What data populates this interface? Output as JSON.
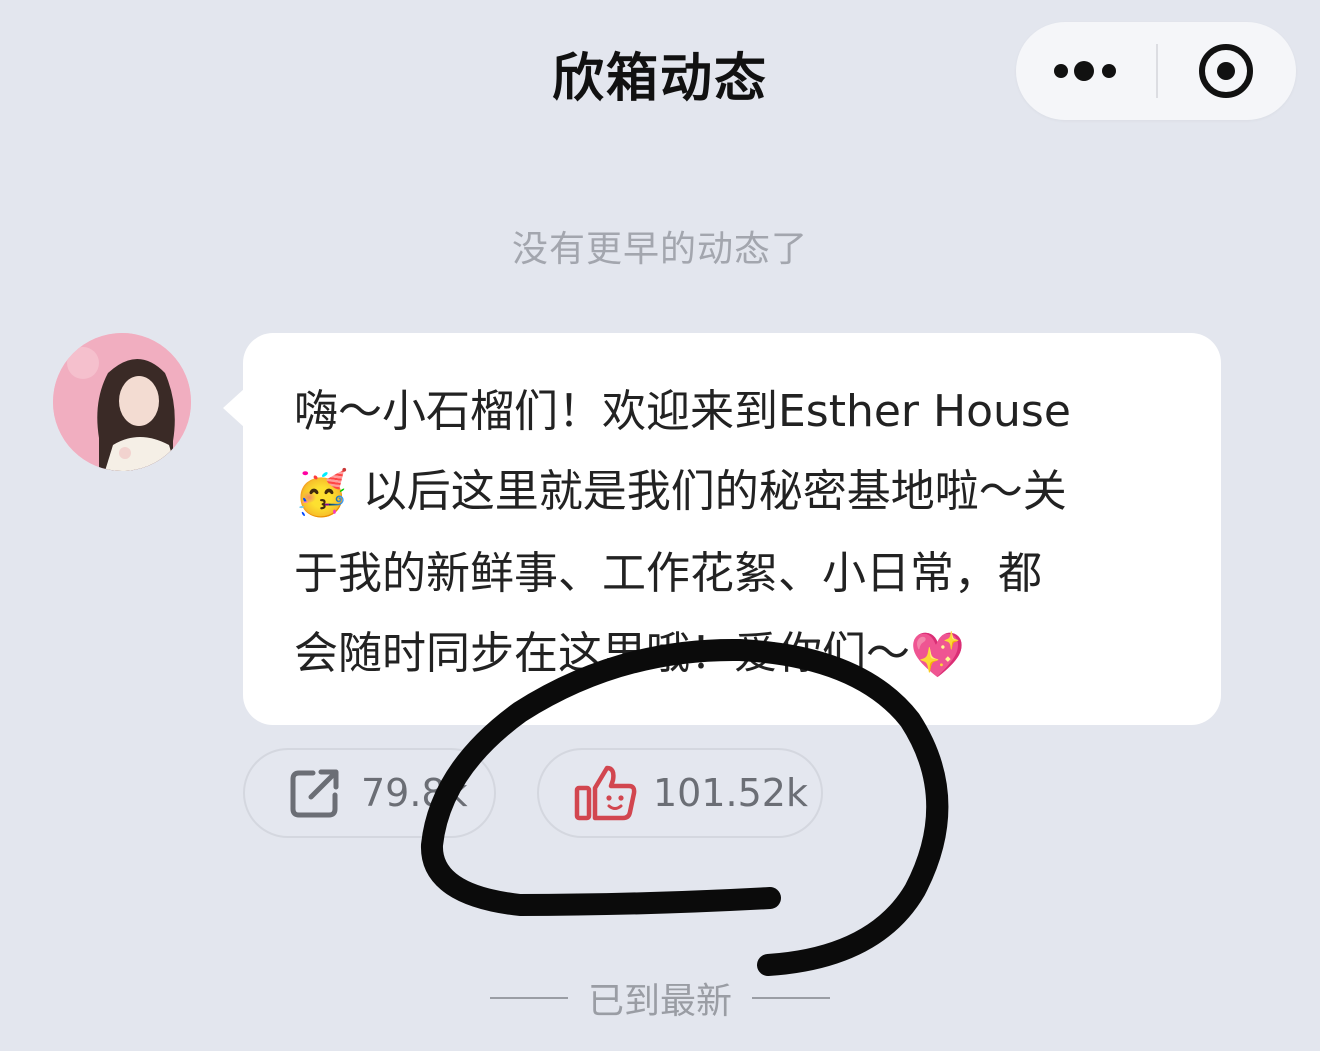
{
  "header": {
    "title": "欣箱动态",
    "more_icon": "more-dots-icon",
    "close_icon": "target-circle-icon"
  },
  "feed": {
    "top_notice": "没有更早的动态了",
    "bottom_notice": "已到最新"
  },
  "post": {
    "lines": [
      "嗨～小石榴们！欢迎来到Esther House",
      " 以后这里就是我们的秘密基地啦～关",
      "于我的新鲜事、工作花絮、小日常，都",
      "会随时同步在这里哦！爱你们～"
    ],
    "emoji_party": "🥳",
    "emoji_heart": "💖"
  },
  "actions": {
    "share_count": "79.8k",
    "like_count": "101.52k",
    "share_icon": "share-icon",
    "like_icon": "thumbs-up-icon"
  },
  "colors": {
    "background": "#e3e6ee",
    "like_icon": "#d2464f",
    "muted_text": "#9a9da4"
  }
}
